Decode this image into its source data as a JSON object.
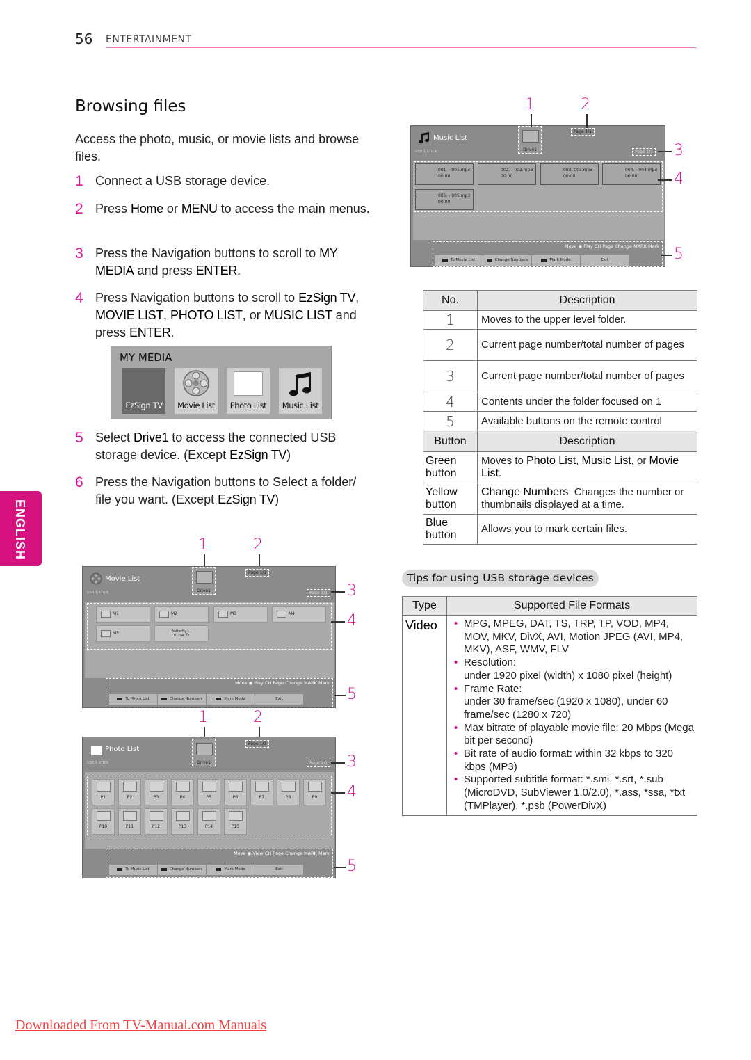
{
  "header": {
    "page_number": "56",
    "section": "ENTERTAINMENT"
  },
  "side_tab": {
    "label": "ENGLISH"
  },
  "title": "Browsing files",
  "intro": "Access the photo, music, or movie lists and browse files.",
  "steps": [
    {
      "n": "1",
      "html": "Connect a USB storage device."
    },
    {
      "n": "2",
      "html": "Press <b>Home</b> or <b>MENU</b> to access the main menus."
    },
    {
      "n": "3",
      "html": "Press the Navigation buttons to scroll to <b>MY MEDIA</b> and press <b>ENTER</b>."
    },
    {
      "n": "4",
      "html": "Press Navigation buttons to scroll to <b>EzSign TV</b>, <b>MOVIE LIST</b>, <b>PHOTO LIST</b>, or <b>MUSIC LIST</b> and press <b>ENTER</b>."
    },
    {
      "n": "5",
      "html": "Select <b>Drive1</b> to access the connected USB storage device. (Except <b>EzSign TV</b>)"
    },
    {
      "n": "6",
      "html": "Press the Navigation buttons to Select a folder/ file you want. (Except <b>EzSign TV</b>)"
    }
  ],
  "my_media": {
    "title": "MY MEDIA",
    "tiles": [
      {
        "label": "EzSign TV",
        "selected": true
      },
      {
        "label": "Movie List"
      },
      {
        "label": "Photo List"
      },
      {
        "label": "Music List"
      }
    ]
  },
  "callouts": [
    "1",
    "2",
    "3",
    "4",
    "5"
  ],
  "screens": {
    "music": {
      "title": "Music List",
      "usb": "USB 1:XTICK",
      "drive": "Drive1",
      "page_top": "Page 1/1",
      "page_right": "Page 1/1",
      "files": [
        {
          "name": "001. - 001.mp3",
          "time": "00:00"
        },
        {
          "name": "002. - 002.mp3",
          "time": "00:00"
        },
        {
          "name": "003. 003.mp3",
          "time": "00:00"
        },
        {
          "name": "004. - 004.mp3",
          "time": "00:00"
        },
        {
          "name": "005. - 005.mp3",
          "time": "00:00"
        }
      ],
      "hints": "Move  ◉ Play  CH Page Change  MARK Mark",
      "buttons": [
        "To Movie List",
        "Change Numbers",
        "Mark Mode",
        "Exit"
      ]
    },
    "movie": {
      "title": "Movie List",
      "usb": "USB 1:XTICK",
      "drive": "Drive1",
      "page_top": "Page 1/1",
      "page_right": "Page 1/1",
      "folders": [
        "M1",
        "M2",
        "M3",
        "M4",
        "M5"
      ],
      "file": {
        "name": "Butterfly_...",
        "time": "01:34:33"
      },
      "hints": "Move  ◉ Play  CH Page Change  MARK Mark",
      "buttons": [
        "To Photo List",
        "Change Numbers",
        "Mark Mode",
        "Exit"
      ]
    },
    "photo": {
      "title": "Photo List",
      "usb": "USB 1:XTICK",
      "drive": "Drive1",
      "page_top": "Page 1/1",
      "page_right": "Page 1/1",
      "folders": [
        "P1",
        "P2",
        "P3",
        "P4",
        "P5",
        "P6",
        "P7",
        "P8",
        "P9",
        "P10",
        "P11",
        "P12",
        "P13",
        "P14",
        "P15"
      ],
      "hints": "Move  ◉ View  CH Page Change  MARK Mark",
      "buttons": [
        "To Music List",
        "Change Numbers",
        "Mark Mode",
        "Exit"
      ]
    }
  },
  "table_numbers": {
    "headers": [
      "No.",
      "Description"
    ],
    "rows": [
      {
        "no": "1",
        "desc": "Moves to the upper level folder."
      },
      {
        "no": "2",
        "desc": "Current page number/total number of pages"
      },
      {
        "no": "3",
        "desc": "Current page number/total number of pages"
      },
      {
        "no": "4",
        "desc": "Contents under the folder focused on 1"
      },
      {
        "no": "5",
        "desc": "Available buttons on the remote control"
      }
    ]
  },
  "table_buttons": {
    "headers": [
      "Button",
      "Description"
    ],
    "rows": [
      {
        "button": "Green button",
        "desc_html": "Moves to <span class=\"kw\">Photo List</span>, <span class=\"kw\">Music List</span>, or <span class=\"kw\">Movie List</span>."
      },
      {
        "button": "Yellow button",
        "desc_html": "<span class=\"kw\">Change Numbers</span>: Changes the number or thumbnails displayed at a time."
      },
      {
        "button": "Blue button",
        "desc_html": "Allows you to mark certain files."
      }
    ]
  },
  "tips": {
    "title": "Tips for using USB storage devices",
    "headers": [
      "Type",
      "Supported File Formats"
    ],
    "type": "Video",
    "bullets": [
      "MPG, MPEG, DAT, TS, TRP, TP, VOD, MP4, MOV, MKV, DivX, AVI, Motion JPEG (AVI, MP4, MKV), ASF, WMV, FLV",
      "Resolution:\nunder 1920 pixel (width) x 1080 pixel (height)",
      "Frame Rate:\nunder 30 frame/sec (1920 x 1080), under 60 frame/sec (1280 x 720)",
      "Max bitrate of playable movie file: 20 Mbps (Mega bit per second)",
      "Bit rate of audio format: within 32 kbps to 320 kbps (MP3)",
      "Supported subtitle format: *.smi, *.srt, *.sub (MicroDVD, SubViewer 1.0/2.0), *.ass, *ssa, *txt (TMPlayer), *.psb (PowerDivX)"
    ]
  },
  "footer": {
    "link_text": "Downloaded From TV-Manual.com Manuals"
  }
}
